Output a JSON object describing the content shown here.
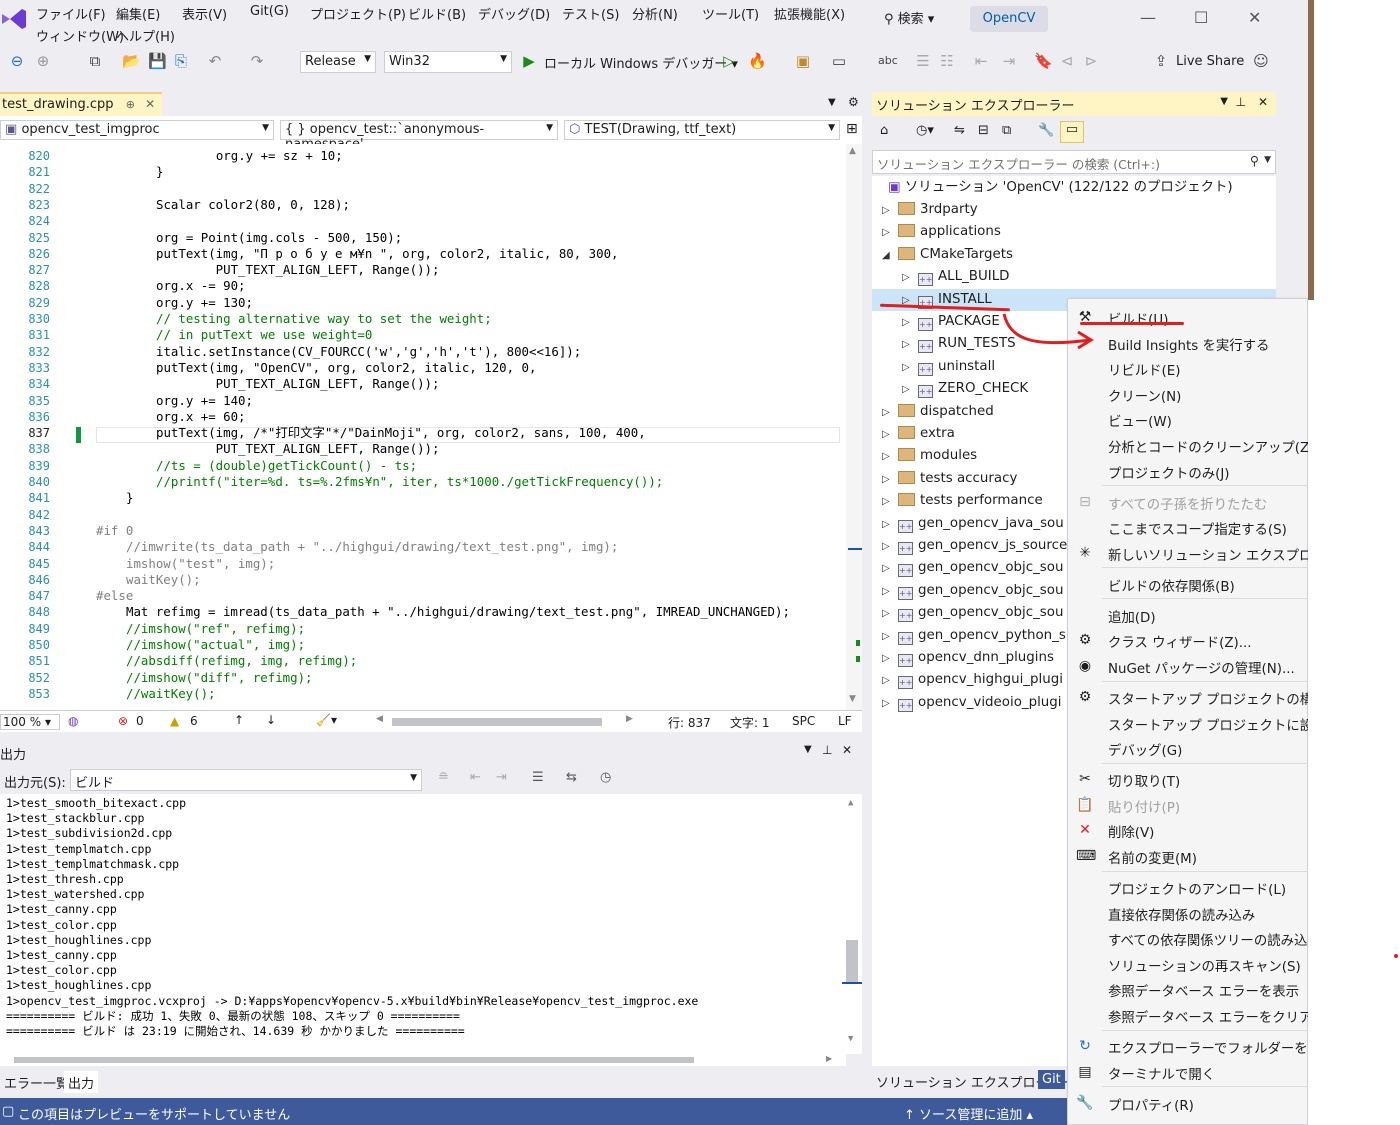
{
  "menu": {
    "file": "ファイル(F)",
    "edit": "編集(E)",
    "view": "表示(V)",
    "git": "Git(G)",
    "project": "プロジェクト(P)",
    "build": "ビルド(B)",
    "debug": "デバッグ(D)",
    "test": "テスト(S)",
    "analyze": "分析(N)",
    "tools": "ツール(T)",
    "extensions": "拡張機能(X)",
    "window": "ウィンドウ(W)",
    "help": "ヘルプ(H)",
    "search": "検索 ▾",
    "project_name": "OpenCV"
  },
  "toolbar": {
    "config": "Release",
    "platform": "Win32",
    "debugger": "ローカル Windows デバッガー ▾",
    "live_share": "Live Share"
  },
  "doc_tab": {
    "title": "test_drawing.cpp",
    "pin": "⊕",
    "close": "✕"
  },
  "nav": {
    "project": "opencv_test_imgproc",
    "scope": "{ } opencv_test::`anonymous-namespace'",
    "member": "TEST(Drawing, ttf_text)"
  },
  "editor": {
    "line_numbers": [
      "820",
      "821",
      "822",
      "823",
      "824",
      "825",
      "826",
      "827",
      "828",
      "829",
      "830",
      "831",
      "832",
      "833",
      "834",
      "835",
      "836",
      "837",
      "838",
      "839",
      "840",
      "841",
      "842",
      "843",
      "844",
      "845",
      "846",
      "847",
      "848",
      "849",
      "850",
      "851",
      "852",
      "853"
    ],
    "lines": [
      {
        "t": "    org.y += sz + 10;",
        "c": "nm",
        "i": 3
      },
      {
        "t": "}",
        "c": "nm",
        "i": 2
      },
      {
        "t": "",
        "c": "nm",
        "i": 0
      },
      {
        "t": "Scalar color2(80, 0, 128);",
        "c": "nm",
        "i": 2
      },
      {
        "t": "",
        "c": "nm",
        "i": 0
      },
      {
        "t": "org = Point(img.cols - 500, 150);",
        "c": "nm",
        "i": 2
      },
      {
        "t": "putText(img, \"П р о б у е м¥n \", org, color2, italic, 80, 300,",
        "c": "nm",
        "i": 2
      },
      {
        "t": "        PUT_TEXT_ALIGN_LEFT, Range());",
        "c": "nm",
        "i": 2
      },
      {
        "t": "org.x -= 90;",
        "c": "nm",
        "i": 2
      },
      {
        "t": "org.y += 130;",
        "c": "nm",
        "i": 2
      },
      {
        "t": "// testing alternative way to set the weight;",
        "c": "cm",
        "i": 2
      },
      {
        "t": "// in putText we use weight=0",
        "c": "cm",
        "i": 2
      },
      {
        "t": "italic.setInstance(CV_FOURCC('w','g','h','t'), 800<<16]);",
        "c": "nm",
        "i": 2
      },
      {
        "t": "putText(img, \"OpenCV\", org, color2, italic, 120, 0,",
        "c": "nm",
        "i": 2
      },
      {
        "t": "        PUT_TEXT_ALIGN_LEFT, Range());",
        "c": "nm",
        "i": 2
      },
      {
        "t": "org.y += 140;",
        "c": "nm",
        "i": 2
      },
      {
        "t": "org.x += 60;",
        "c": "nm",
        "i": 2
      },
      {
        "t": "putText(img, /*\"打印文字\"*/\"DainMoji\", org, color2, sans, 100, 400,",
        "c": "nm",
        "i": 2
      },
      {
        "t": "        PUT_TEXT_ALIGN_LEFT, Range());",
        "c": "nm",
        "i": 2
      },
      {
        "t": "//ts = (double)getTickCount() - ts;",
        "c": "cm",
        "i": 2
      },
      {
        "t": "//printf(\"iter=%d. ts=%.2fms¥n\", iter, ts*1000./getTickFrequency());",
        "c": "cm",
        "i": 2
      },
      {
        "t": "}",
        "c": "nm",
        "i": 1
      },
      {
        "t": "",
        "c": "nm",
        "i": 0
      },
      {
        "t": "#if 0",
        "c": "pp",
        "i": 0
      },
      {
        "t": "//imwrite(ts_data_path + \"../highgui/drawing/text_test.png\", img);",
        "c": "gr",
        "i": 1
      },
      {
        "t": "imshow(\"test\", img);",
        "c": "gr",
        "i": 1
      },
      {
        "t": "waitKey();",
        "c": "gr",
        "i": 1
      },
      {
        "t": "#else",
        "c": "pp",
        "i": 0
      },
      {
        "t": "Mat refimg = imread(ts_data_path + \"../highgui/drawing/text_test.png\", IMREAD_UNCHANGED);",
        "c": "nm",
        "i": 1
      },
      {
        "t": "//imshow(\"ref\", refimg);",
        "c": "cm",
        "i": 1
      },
      {
        "t": "//imshow(\"actual\", img);",
        "c": "cm",
        "i": 1
      },
      {
        "t": "//absdiff(refimg, img, refimg);",
        "c": "cm",
        "i": 1
      },
      {
        "t": "//imshow(\"diff\", refimg);",
        "c": "cm",
        "i": 1
      },
      {
        "t": "//waitKey();",
        "c": "cm",
        "i": 1
      }
    ]
  },
  "status_line": {
    "zoom": "100 %",
    "errors": "0",
    "warnings": "6",
    "line": "行: 837",
    "col": "文字: 1",
    "spc": "SPC",
    "eol": "LF"
  },
  "output": {
    "title": "出力",
    "source_label": "出力元(S):",
    "source_value": "ビルド",
    "lines": [
      "1>test_smooth_bitexact.cpp",
      "1>test_stackblur.cpp",
      "1>test_subdivision2d.cpp",
      "1>test_templmatch.cpp",
      "1>test_templmatchmask.cpp",
      "1>test_thresh.cpp",
      "1>test_watershed.cpp",
      "1>test_canny.cpp",
      "1>test_color.cpp",
      "1>test_houghlines.cpp",
      "1>test_canny.cpp",
      "1>test_color.cpp",
      "1>test_houghlines.cpp",
      "1>opencv_test_imgproc.vcxproj -> D:¥apps¥opencv¥opencv-5.x¥build¥bin¥Release¥opencv_test_imgproc.exe",
      "========== ビルド: 成功 1、失敗 0、最新の状態 108、スキップ 0 ==========",
      "========== ビルド は 23:19 に開始され、14.639 秒 かかりました =========="
    ]
  },
  "bottom_tabs": {
    "errors": "エラー一覧",
    "output": "出力"
  },
  "statusbar": {
    "left": "この項目はプレビューをサポートしていません",
    "right": "↑ ソース管理に追加 ▴"
  },
  "solution_explorer": {
    "title": "ソリューション エクスプローラー",
    "search_placeholder": "ソリューション エクスプローラー の検索 (Ctrl+:)",
    "root": "ソリューション 'OpenCV' (122/122 のプロジェクト)",
    "items": [
      {
        "label": "3rdparty",
        "kind": "folder",
        "level": 0,
        "exp": "▷"
      },
      {
        "label": "applications",
        "kind": "folder",
        "level": 0,
        "exp": "▷"
      },
      {
        "label": "CMakeTargets",
        "kind": "folder",
        "level": 0,
        "exp": "◢"
      },
      {
        "label": "ALL_BUILD",
        "kind": "proj",
        "level": 1,
        "exp": "▷"
      },
      {
        "label": "INSTALL",
        "kind": "proj",
        "level": 1,
        "exp": "▷",
        "selected": true
      },
      {
        "label": "PACKAGE",
        "kind": "proj",
        "level": 1,
        "exp": "▷"
      },
      {
        "label": "RUN_TESTS",
        "kind": "proj",
        "level": 1,
        "exp": "▷"
      },
      {
        "label": "uninstall",
        "kind": "proj",
        "level": 1,
        "exp": "▷"
      },
      {
        "label": "ZERO_CHECK",
        "kind": "proj",
        "level": 1,
        "exp": "▷"
      },
      {
        "label": "dispatched",
        "kind": "folder",
        "level": 0,
        "exp": "▷"
      },
      {
        "label": "extra",
        "kind": "folder",
        "level": 0,
        "exp": "▷"
      },
      {
        "label": "modules",
        "kind": "folder",
        "level": 0,
        "exp": "▷"
      },
      {
        "label": "tests accuracy",
        "kind": "folder",
        "level": 0,
        "exp": "▷"
      },
      {
        "label": "tests performance",
        "kind": "folder",
        "level": 0,
        "exp": "▷"
      },
      {
        "label": "gen_opencv_java_sou",
        "kind": "proj",
        "level": 0,
        "exp": "▷"
      },
      {
        "label": "gen_opencv_js_source",
        "kind": "proj",
        "level": 0,
        "exp": "▷"
      },
      {
        "label": "gen_opencv_objc_sou",
        "kind": "proj",
        "level": 0,
        "exp": "▷"
      },
      {
        "label": "gen_opencv_objc_sou",
        "kind": "proj",
        "level": 0,
        "exp": "▷"
      },
      {
        "label": "gen_opencv_objc_sou",
        "kind": "proj",
        "level": 0,
        "exp": "▷"
      },
      {
        "label": "gen_opencv_python_s",
        "kind": "proj",
        "level": 0,
        "exp": "▷"
      },
      {
        "label": "opencv_dnn_plugins",
        "kind": "proj",
        "level": 0,
        "exp": "▷"
      },
      {
        "label": "opencv_highgui_plugi",
        "kind": "proj",
        "level": 0,
        "exp": "▷"
      },
      {
        "label": "opencv_videoio_plugi",
        "kind": "proj",
        "level": 0,
        "exp": "▷"
      }
    ],
    "bottom_tab": "ソリューション エクスプローラー",
    "git_tab": "Git"
  },
  "context_menu": {
    "items": [
      {
        "label": "ビルド(U)",
        "icon": "build-icon",
        "glyph": "⚒"
      },
      {
        "label": "Build Insights を実行する"
      },
      {
        "label": "リビルド(E)"
      },
      {
        "label": "クリーン(N)"
      },
      {
        "label": "ビュー(W)"
      },
      {
        "label": "分析とコードのクリーンアップ(Z)"
      },
      {
        "label": "プロジェクトのみ(J)",
        "sep_after": true
      },
      {
        "label": "すべての子孫を折りたたむ",
        "disabled": true,
        "icon": "collapse-icon",
        "glyph": "⊟"
      },
      {
        "label": "ここまでスコープ指定する(S)"
      },
      {
        "label": "新しいソリューション エクスプローラーの",
        "icon": "new-explorer-icon",
        "glyph": "✳",
        "sep_after": true
      },
      {
        "label": "ビルドの依存関係(B)",
        "sep_after": true
      },
      {
        "label": "追加(D)"
      },
      {
        "label": "クラス ウィザード(Z)...",
        "icon": "class-wizard-icon",
        "glyph": "⚙"
      },
      {
        "label": "NuGet パッケージの管理(N)...",
        "icon": "nuget-icon",
        "glyph": "◉",
        "sep_after": true
      },
      {
        "label": "スタートアップ プロジェクトの構成...",
        "icon": "gear-icon",
        "glyph": "⚙"
      },
      {
        "label": "スタートアップ プロジェクトに設定(A)"
      },
      {
        "label": "デバッグ(G)",
        "sep_after": true
      },
      {
        "label": "切り取り(T)",
        "icon": "cut-icon",
        "glyph": "✂"
      },
      {
        "label": "貼り付け(P)",
        "disabled": true,
        "icon": "paste-icon",
        "glyph": "📋"
      },
      {
        "label": "削除(V)",
        "icon": "delete-icon",
        "glyph": "✕",
        "glyph_color": "#e02020"
      },
      {
        "label": "名前の変更(M)",
        "icon": "rename-icon",
        "glyph": "⌨",
        "sep_after": true
      },
      {
        "label": "プロジェクトのアンロード(L)"
      },
      {
        "label": "直接依存関係の読み込み"
      },
      {
        "label": "すべての依存関係ツリーの読み込み"
      },
      {
        "label": "ソリューションの再スキャン(S)"
      },
      {
        "label": "参照データベース エラーを表示"
      },
      {
        "label": "参照データベース エラーをクリア",
        "sep_after": true
      },
      {
        "label": "エクスプローラーでフォルダーを開く(X)",
        "icon": "refresh-icon",
        "glyph": "↻",
        "glyph_color": "#1e6fd0"
      },
      {
        "label": "ターミナルで開く",
        "icon": "terminal-icon",
        "glyph": "▤",
        "sep_after": true
      },
      {
        "label": "プロパティ(R)",
        "icon": "wrench-icon",
        "glyph": "🔧"
      }
    ]
  },
  "colors": {
    "accent": "#3e5a9a",
    "selection": "#cce4f7",
    "tab_active": "#fff4c4",
    "annotation": "#e02020"
  }
}
